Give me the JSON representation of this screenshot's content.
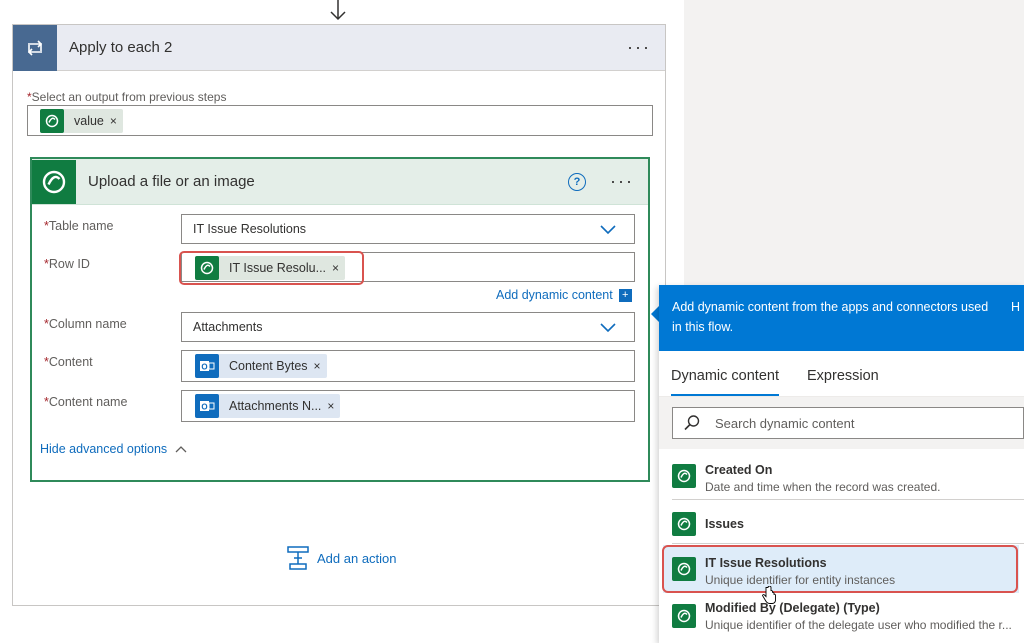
{
  "loop": {
    "title": "Apply to each 2",
    "more": "···",
    "output_label": "Select an output from previous steps",
    "required_mark": "*",
    "output_token": {
      "label": "value",
      "remove": "×",
      "icon": "dataverse-icon"
    }
  },
  "action": {
    "title": "Upload a file or an image",
    "help": "?",
    "more": "···",
    "fields": {
      "table_name": {
        "label": "Table name",
        "value": "IT Issue Resolutions"
      },
      "row_id": {
        "label": "Row ID",
        "token": "IT Issue Resolu...",
        "remove": "×"
      },
      "column_name": {
        "label": "Column name",
        "value": "Attachments"
      },
      "content": {
        "label": "Content",
        "token": "Content Bytes",
        "remove": "×"
      },
      "content_name": {
        "label": "Content name",
        "token": "Attachments N...",
        "remove": "×"
      }
    },
    "add_dynamic": "Add dynamic content",
    "add_dynamic_plus": "+",
    "hide_advanced": "Hide advanced options"
  },
  "add_action": "Add an action",
  "panel": {
    "header_text": "Add dynamic content from the apps and connectors used in this flow.",
    "header_cut": "H",
    "tabs": [
      "Dynamic content",
      "Expression"
    ],
    "search_placeholder": "Search dynamic content",
    "items": [
      {
        "title": "Created On",
        "desc": "Date and time when the record was created."
      },
      {
        "title": "Issues",
        "desc": ""
      },
      {
        "title": "IT Issue Resolutions",
        "desc": "Unique identifier for entity instances"
      },
      {
        "title": "Modified By (Delegate) (Type)",
        "desc": "Unique identifier of the delegate user who modified the r..."
      }
    ]
  },
  "colors": {
    "accent": "#0078d4",
    "dataverse": "#107c41",
    "outlook": "#0f6cbd",
    "highlight": "#d9534f"
  }
}
